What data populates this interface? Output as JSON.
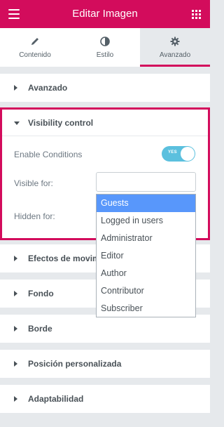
{
  "header": {
    "title": "Editar Imagen",
    "menu_icon": "hamburger-menu-icon",
    "apps_icon": "grid-apps-icon"
  },
  "tabs": [
    {
      "label": "Contenido",
      "icon": "pencil-icon",
      "active": false
    },
    {
      "label": "Estilo",
      "icon": "half-circle-icon",
      "active": false
    },
    {
      "label": "Avanzado",
      "icon": "gear-icon",
      "active": true
    }
  ],
  "sections": {
    "advanced": "Avanzado",
    "visibility": "Visibility control",
    "motion": "Efectos de movimiento",
    "background": "Fondo",
    "border": "Borde",
    "custom_position": "Posición personalizada",
    "responsive": "Adaptabilidad"
  },
  "visibility_control": {
    "enable_conditions_label": "Enable Conditions",
    "toggle_text": "YES",
    "toggle_on": true,
    "visible_for_label": "Visible for:",
    "hidden_for_label": "Hidden for:",
    "visible_for_value": ""
  },
  "dropdown": {
    "options": [
      "Guests",
      "Logged in users",
      "Administrator",
      "Editor",
      "Author",
      "Contributor",
      "Subscriber"
    ],
    "highlighted": "Guests"
  },
  "colors": {
    "brand": "#d30c5c",
    "toggle": "#5bc0de",
    "highlight": "#5897fb"
  }
}
